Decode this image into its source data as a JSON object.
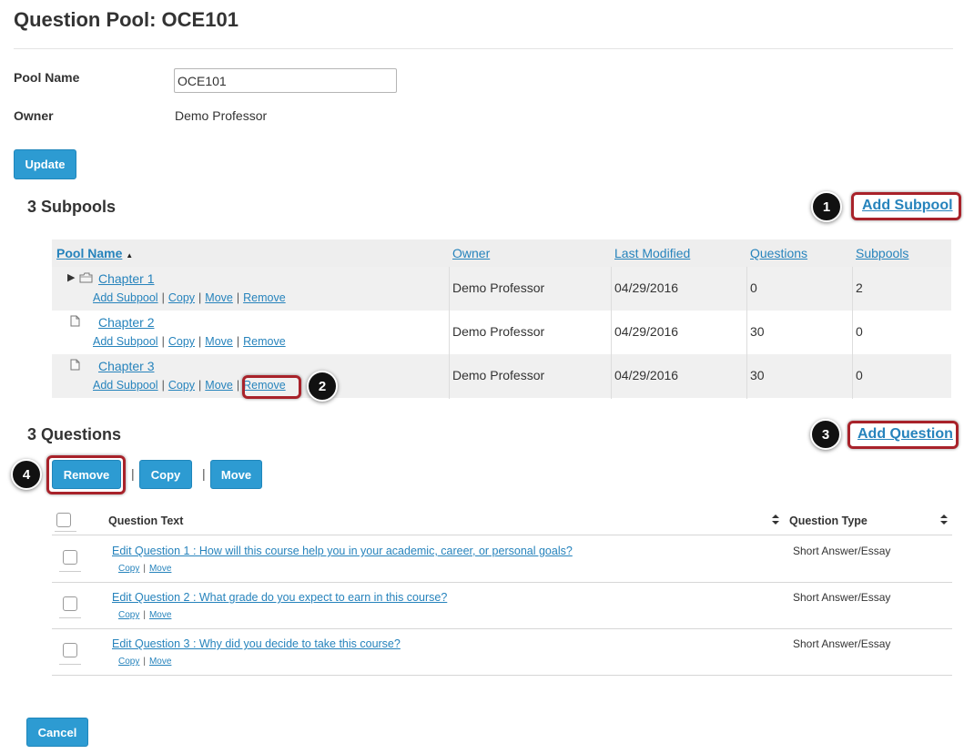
{
  "page": {
    "title": "Question Pool: OCE101"
  },
  "form": {
    "pool_name_label": "Pool Name",
    "pool_name_value": "OCE101",
    "owner_label": "Owner",
    "owner_value": "Demo Professor",
    "update_button": "Update"
  },
  "subpools": {
    "heading": "3 Subpools",
    "add_link": "Add Subpool",
    "callout_add": "1",
    "callout_remove": "2",
    "columns": {
      "pool_name": "Pool Name",
      "sort_indicator": "▲",
      "owner": "Owner",
      "last_modified": "Last Modified",
      "questions": "Questions",
      "subpools": "Subpools"
    },
    "rows": [
      {
        "name": "Chapter 1",
        "icon": "folder-icon",
        "expandable": true,
        "owner": "Demo Professor",
        "modified": "04/29/2016",
        "questions": "0",
        "subpools": "2",
        "actions": [
          "Add Subpool",
          "Copy",
          "Move",
          "Remove"
        ]
      },
      {
        "name": "Chapter 2",
        "icon": "document-icon",
        "expandable": false,
        "owner": "Demo Professor",
        "modified": "04/29/2016",
        "questions": "30",
        "subpools": "0",
        "actions": [
          "Add Subpool",
          "Copy",
          "Move",
          "Remove"
        ]
      },
      {
        "name": "Chapter 3",
        "icon": "document-icon",
        "expandable": false,
        "owner": "Demo Professor",
        "modified": "04/29/2016",
        "questions": "30",
        "subpools": "0",
        "actions": [
          "Add Subpool",
          "Copy",
          "Move",
          "Remove"
        ]
      }
    ]
  },
  "questions": {
    "heading": "3 Questions",
    "add_link": "Add Question",
    "callout_add": "3",
    "callout_remove": "4",
    "buttons": {
      "remove": "Remove",
      "copy": "Copy",
      "move": "Move",
      "divider": "|"
    },
    "columns": {
      "text": "Question Text",
      "type": "Question Type"
    },
    "rows": [
      {
        "text": "Edit Question 1 : How will this course help you in your academic, career, or personal goals?",
        "type": "Short Answer/Essay",
        "copy": "Copy",
        "move": "Move"
      },
      {
        "text": "Edit Question 2 : What grade do you expect to earn in this course?",
        "type": "Short Answer/Essay",
        "copy": "Copy",
        "move": "Move"
      },
      {
        "text": "Edit Question 3 : Why did you decide to take this course?",
        "type": "Short Answer/Essay",
        "copy": "Copy",
        "move": "Move"
      }
    ]
  },
  "footer": {
    "cancel_button": "Cancel"
  },
  "colors": {
    "accent": "#2d9bd2",
    "link": "#2683bc",
    "highlight": "#a8222a"
  }
}
